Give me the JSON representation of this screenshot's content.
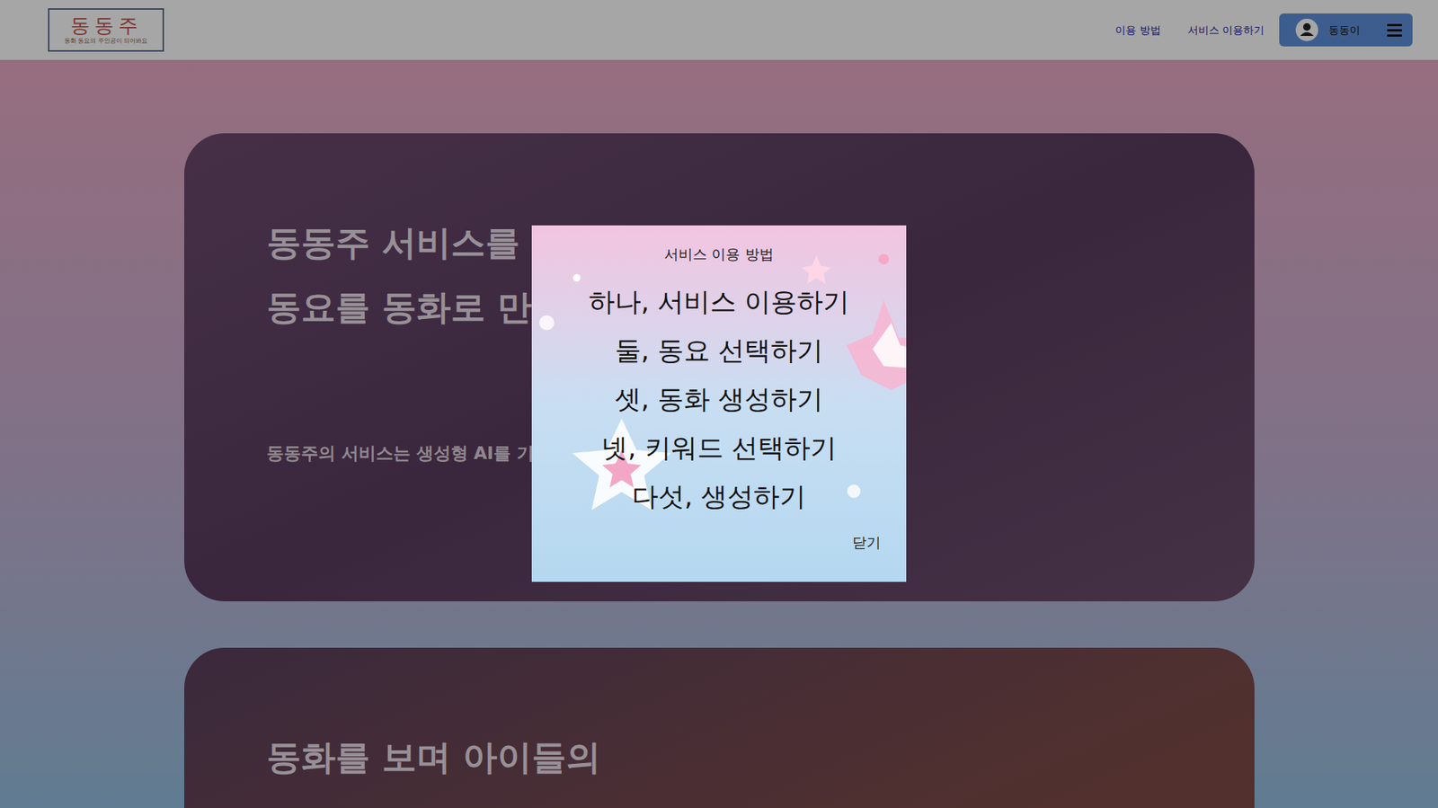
{
  "header": {
    "logo": {
      "title": "동동주",
      "subtitle": "동화 동요의 주인공이 되어봐요"
    },
    "nav": [
      "이용 방법",
      "서비스 이용하기"
    ],
    "user": {
      "name": "동동이"
    }
  },
  "cards": [
    {
      "title_lines": [
        "동동주 서비스를 활",
        "동요를 동화로 만들"
      ],
      "text": "동동주의 서비스는 생성형 AI를 기반으"
    },
    {
      "title_lines": [
        "동화를 보며 아이들의"
      ]
    }
  ],
  "modal": {
    "title": "서비스 이용 방법",
    "steps": [
      "하나, 서비스 이용하기",
      "둘, 동요 선택하기",
      "셋, 동화 생성하기",
      "넷, 키워드 선택하기",
      "다섯, 생성하기"
    ],
    "close": "닫기"
  }
}
